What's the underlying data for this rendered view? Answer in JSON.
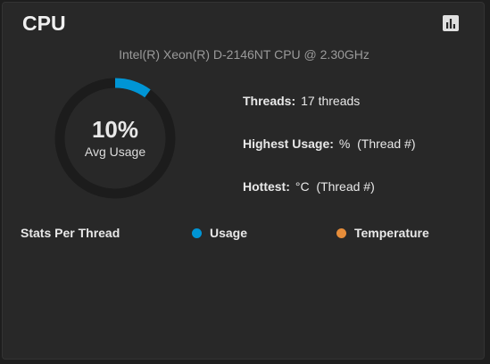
{
  "card": {
    "title": "CPU",
    "chart_button_icon": "bar-chart-icon",
    "cpu_model": "Intel(R) Xeon(R) D-2146NT CPU @ 2.30GHz"
  },
  "gauge": {
    "value_text": "10%",
    "label": "Avg Usage",
    "fraction": 0.1,
    "fill_color": "#0095d5",
    "track_color": "#1c1c1c"
  },
  "stats": {
    "threads_label": "Threads:",
    "threads_value": "17 threads",
    "highest_label": "Highest Usage:",
    "highest_value": "%  (Thread #)",
    "hottest_label": "Hottest:",
    "hottest_value": "°C  (Thread #)"
  },
  "legend": {
    "title": "Stats Per Thread",
    "usage_label": "Usage",
    "usage_color": "#0095d5",
    "temperature_label": "Temperature",
    "temperature_color": "#e68d3a"
  }
}
